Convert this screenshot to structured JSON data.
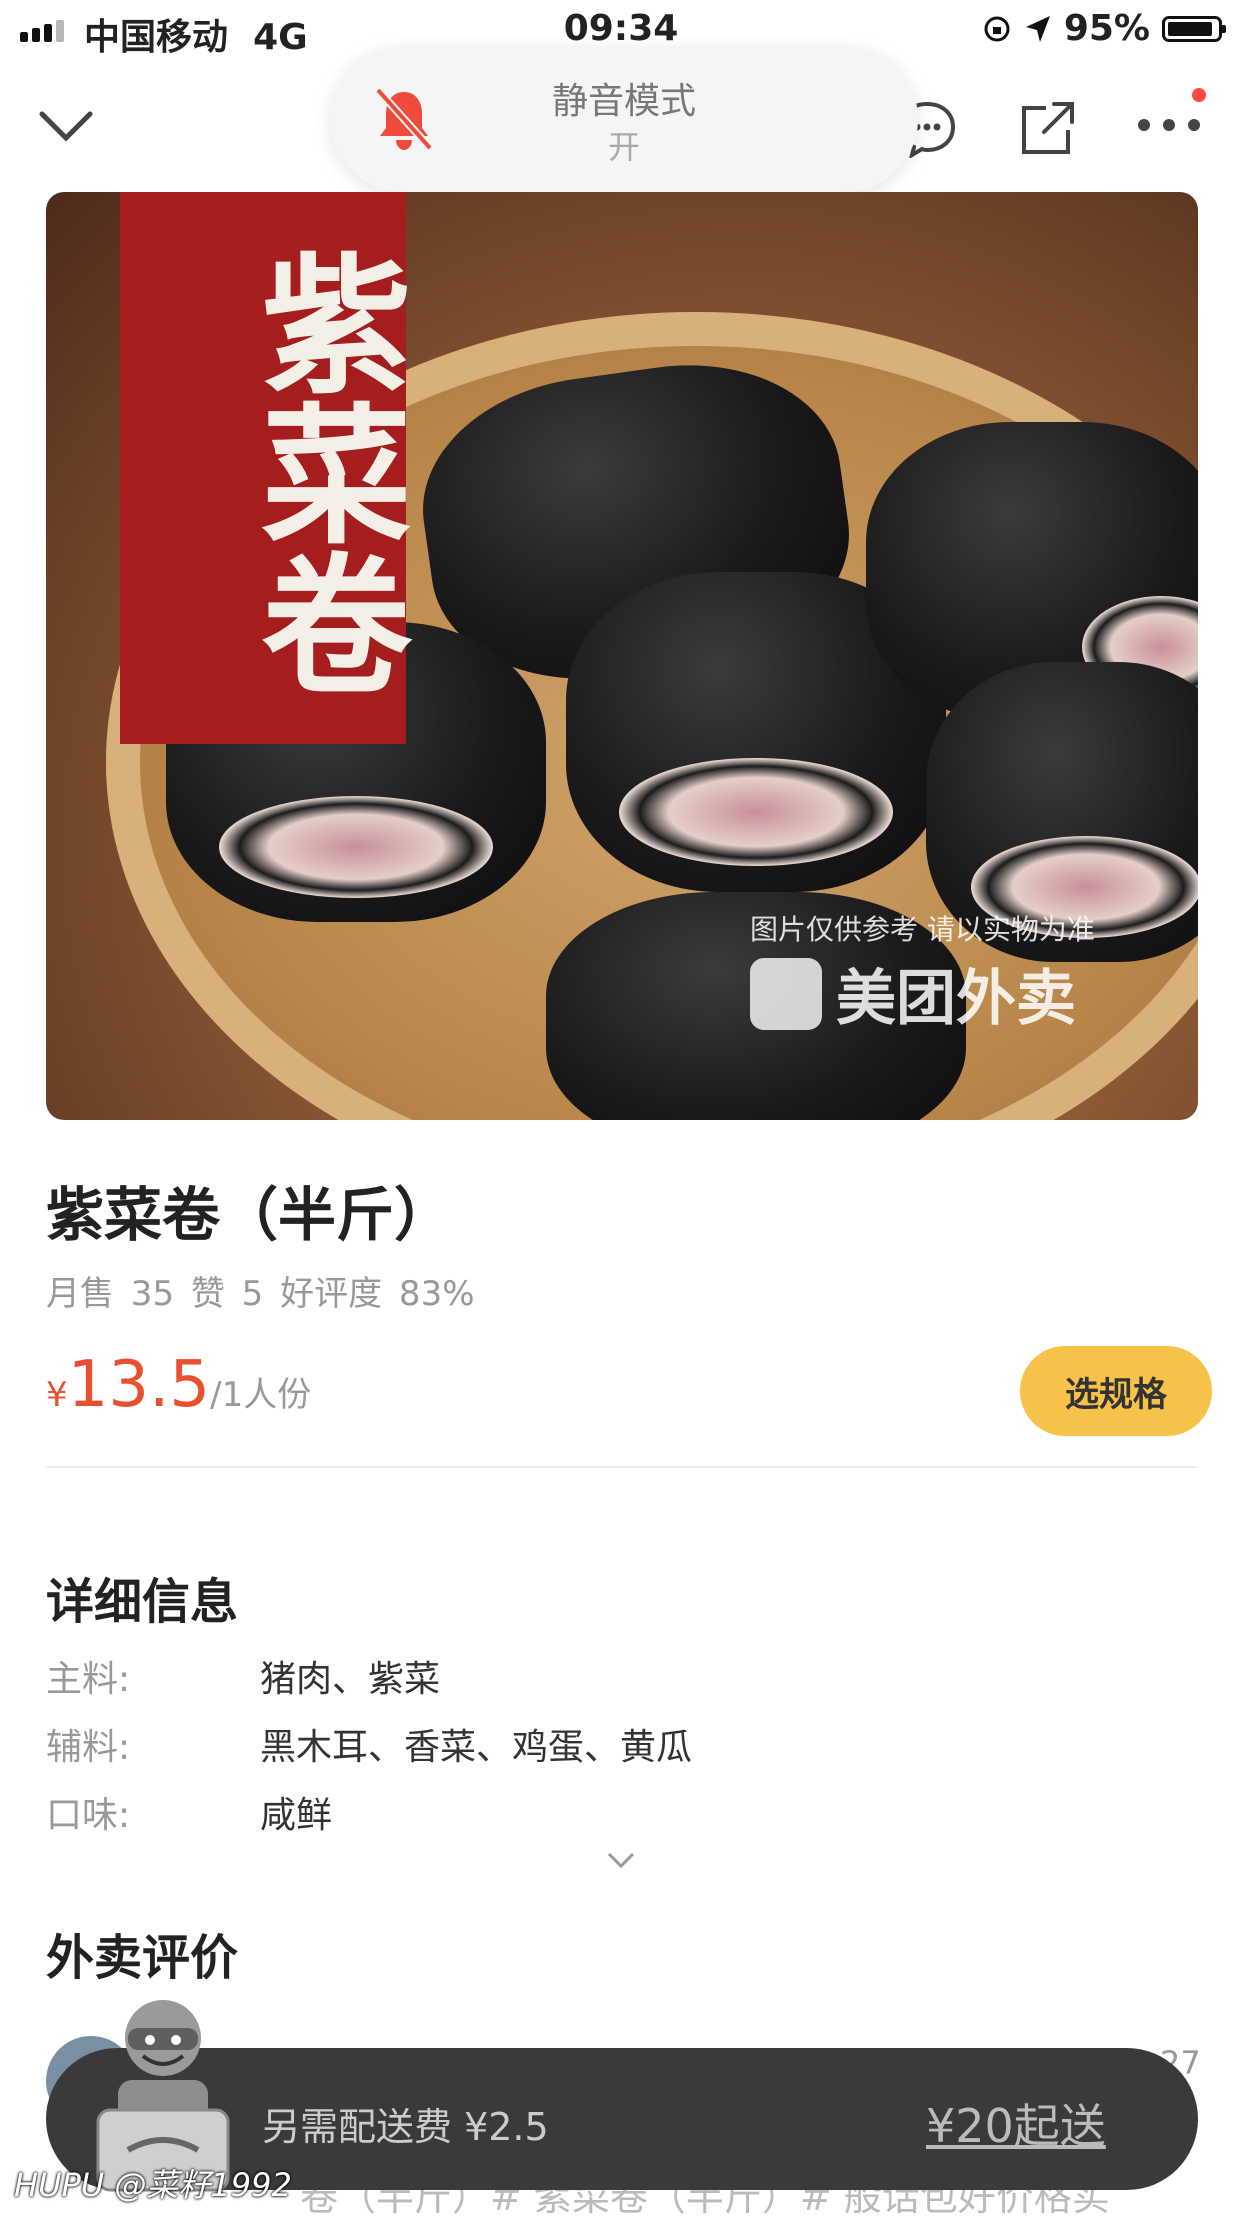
{
  "status_bar": {
    "carrier": "中国移动",
    "network": "4G",
    "time": "09:34",
    "battery": "95%"
  },
  "toast": {
    "title": "静音模式",
    "state": "开"
  },
  "hero": {
    "banner_text": "紫菜卷",
    "watermark_note": "图片仅供参考 请以实物为准",
    "watermark_brand": "美团外卖"
  },
  "product": {
    "name": "紫菜卷（半斤）",
    "stats": "月售 35   赞 5   好评度 83%",
    "currency": "¥",
    "price": "13.5",
    "unit": "/1人份",
    "spec_button": "选规格"
  },
  "details": {
    "title": "详细信息",
    "rows": [
      {
        "key": "主料:",
        "value": "猪肉、紫菜"
      },
      {
        "key": "辅料:",
        "value": "黑木耳、香菜、鸡蛋、黄瓜"
      },
      {
        "key": "口味:",
        "value": "咸鲜"
      }
    ]
  },
  "reviews": {
    "title": "外卖评价",
    "date_partial": "27",
    "tags_partial": "卷（半斤）# 紫菜卷（半斤）# 般话包好价格实"
  },
  "cart": {
    "fee_text": "另需配送费 ¥2.5",
    "min_order": "¥20起送"
  },
  "watermark": "HUPU @菜籽1992",
  "colors": {
    "price": "#e8502f",
    "button": "#f7c24a",
    "cart_bar": "#3a3a3a",
    "banner": "#a51d1d",
    "notification_dot": "#ff4a3d"
  }
}
